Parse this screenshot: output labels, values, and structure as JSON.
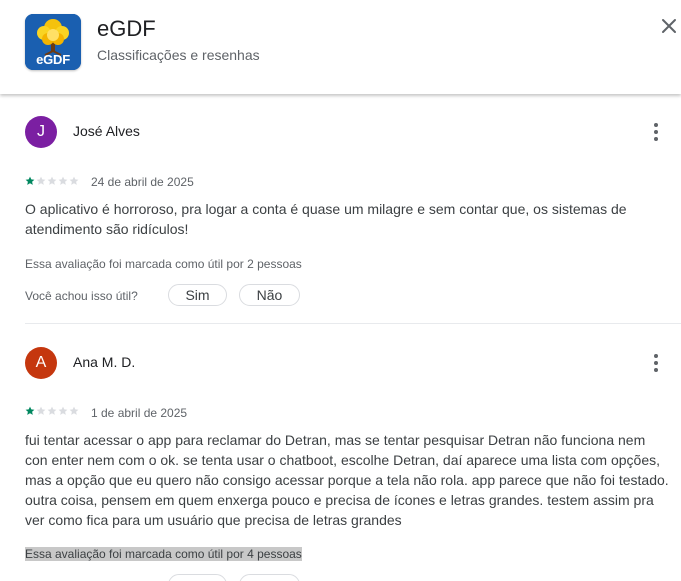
{
  "app": {
    "name": "eGDF",
    "subtitle": "Classificações e resenhas",
    "icon_label": "eGDF"
  },
  "colors": {
    "star_filled": "#01875f",
    "star_empty": "#dadce0",
    "avatar_j": "#7b1fa2",
    "avatar_a": "#c5370e"
  },
  "reviews": [
    {
      "avatar_letter": "J",
      "author": "José Alves",
      "rating": 1,
      "date": "24 de abril de 2025",
      "text": "O aplicativo é horroroso, pra logar a conta é quase um milagre e sem contar que, os sistemas de atendimento são ridículos!",
      "helpful_count": "Essa avaliação foi marcada como útil por 2 pessoas",
      "helpful_question": "Você achou isso útil?",
      "yes_label": "Sim",
      "no_label": "Não"
    },
    {
      "avatar_letter": "A",
      "author": "Ana M. D.",
      "rating": 1,
      "date": "1 de abril de 2025",
      "text": "fui tentar acessar o app para reclamar do Detran, mas se tentar pesquisar Detran não funciona nem con enter nem com o ok. se tenta usar o chatboot, escolhe Detran, daí aparece uma lista com opções, mas a opção que eu quero não consigo acessar porque a tela não rola. app parece que não foi testado. outra coisa, pensem em quem enxerga pouco e precisa de ícones e letras grandes. testem assim pra ver como fica para um usuário que precisa de letras grandes",
      "helpful_count": "Essa avaliação foi marcada como útil por 4 pessoas"
    }
  ]
}
